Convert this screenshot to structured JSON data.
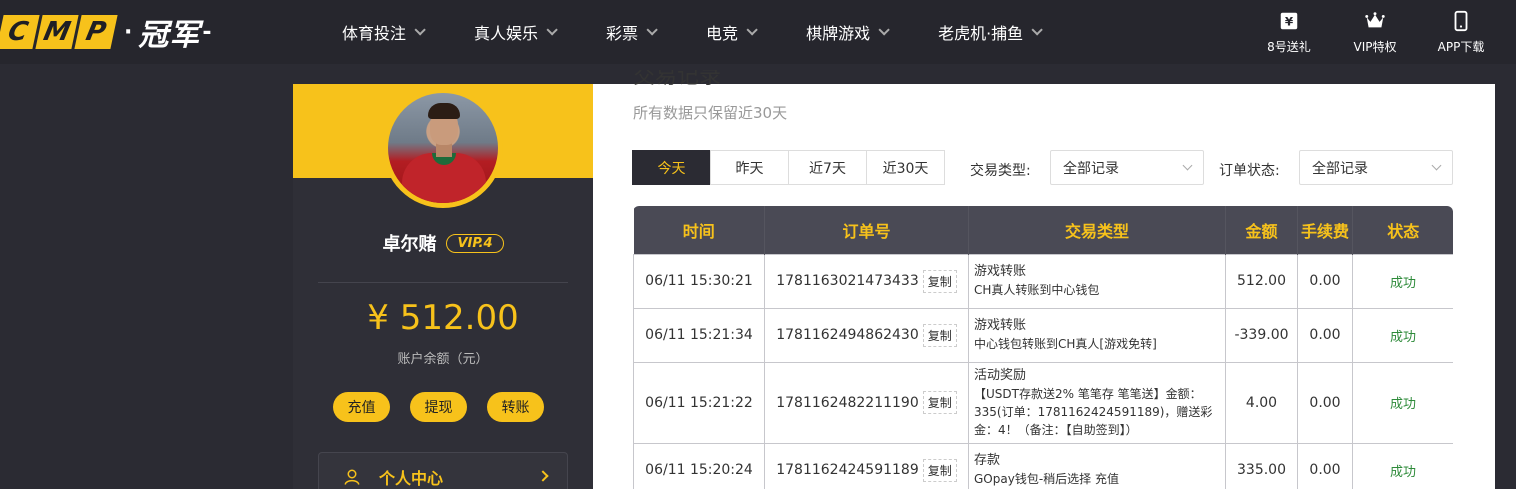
{
  "header": {
    "logo_letters": [
      "C",
      "M",
      "P"
    ],
    "logo_dot": "·",
    "logo_text": "冠军",
    "logo_dash": "-",
    "nav": [
      {
        "label": "体育投注"
      },
      {
        "label": "真人娱乐"
      },
      {
        "label": "彩票"
      },
      {
        "label": "电竞"
      },
      {
        "label": "棋牌游戏"
      },
      {
        "label": "老虎机·捕鱼"
      }
    ],
    "icons": [
      {
        "label": "8号送礼",
        "icon": "gift-yen-icon"
      },
      {
        "label": "VIP特权",
        "icon": "crown-icon"
      },
      {
        "label": "APP下载",
        "icon": "phone-icon"
      }
    ]
  },
  "profile": {
    "username": "卓尔赌",
    "vip": "VIP.4",
    "balance": "¥ 512.00",
    "balance_label": "账户余额（元）",
    "actions": [
      "充值",
      "提现",
      "转账"
    ],
    "menu_label": "个人中心"
  },
  "records": {
    "heading": "交易记录",
    "note": "所有数据只保留近30天",
    "date_tabs": [
      "今天",
      "昨天",
      "近7天",
      "近30天"
    ],
    "filter_type_label": "交易类型:",
    "filter_type_value": "全部记录",
    "filter_status_label": "订单状态:",
    "filter_status_value": "全部记录",
    "columns": [
      "时间",
      "订单号",
      "交易类型",
      "金额",
      "手续费",
      "状态"
    ],
    "copy_label": "复制",
    "rows": [
      {
        "time": "06/11 15:30:21",
        "order": "1781163021473433",
        "type": "游戏转账",
        "desc": "CH真人转账到中心钱包",
        "amount": "512.00",
        "fee": "0.00",
        "status": "成功"
      },
      {
        "time": "06/11 15:21:34",
        "order": "1781162494862430",
        "type": "游戏转账",
        "desc": "中心钱包转账到CH真人[游戏免转]",
        "amount": "-339.00",
        "fee": "0.00",
        "status": "成功"
      },
      {
        "time": "06/11 15:21:22",
        "order": "1781162482211190",
        "type": "活动奖励",
        "desc": "【USDT存款送2% 笔笔存 笔笔送】金额：335(订单：1781162424591189)，赠送彩金：4！（备注：【自助签到】）",
        "amount": "4.00",
        "fee": "0.00",
        "status": "成功"
      },
      {
        "time": "06/11 15:20:24",
        "order": "1781162424591189",
        "type": "存款",
        "desc": "GOpay钱包-稍后选择 充值",
        "amount": "335.00",
        "fee": "0.00",
        "status": "成功"
      }
    ]
  }
}
